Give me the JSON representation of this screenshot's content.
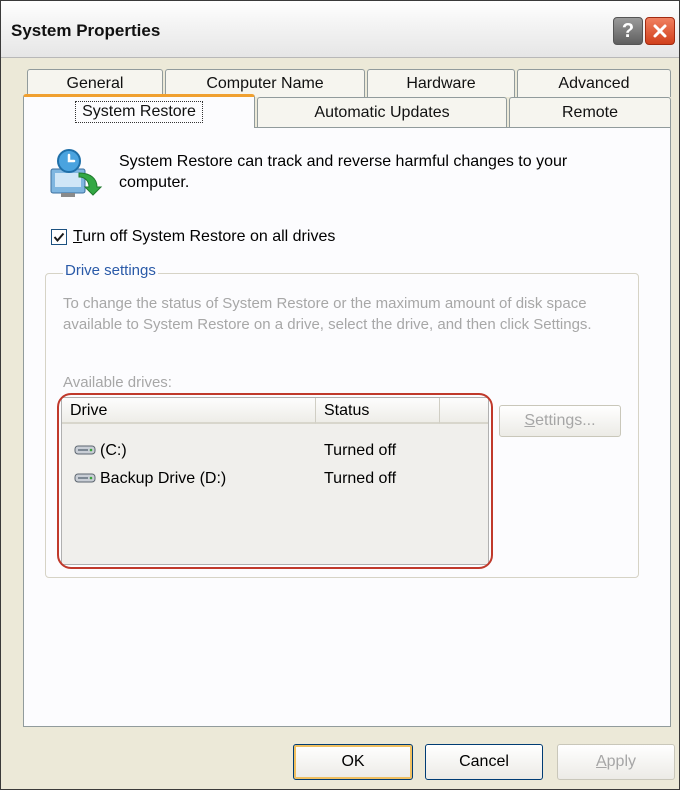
{
  "window": {
    "title": "System Properties",
    "help_glyph": "?",
    "icons": {
      "help": "question-mark-icon",
      "close": "close-icon"
    },
    "colors": {
      "accent_tab": "#f0a030",
      "close_button": "#d1401c",
      "highlight_ring": "#c0392b",
      "group_legend": "#2a5aa8"
    }
  },
  "tabs": {
    "back_row": [
      "General",
      "Computer Name",
      "Hardware",
      "Advanced"
    ],
    "front_row": [
      "System Restore",
      "Automatic Updates",
      "Remote"
    ],
    "active": "System Restore"
  },
  "intro": {
    "icon": "system-restore-icon",
    "text": "System Restore can track and reverse harmful changes to your computer."
  },
  "turn_off": {
    "checked": true,
    "label_accel": "T",
    "label_rest": "urn off System Restore on all drives"
  },
  "drive_settings": {
    "legend": "Drive settings",
    "description": "To change the status of System Restore or the maximum amount of disk space available to System Restore on a drive, select the drive, and then click Settings.",
    "available_label": "Available drives:",
    "columns": [
      "Drive",
      "Status"
    ],
    "rows": [
      {
        "drive": "(C:)",
        "status": "Turned off",
        "icon": "hard-drive-icon"
      },
      {
        "drive": "Backup Drive (D:)",
        "status": "Turned off",
        "icon": "hard-drive-icon"
      }
    ],
    "settings_button": {
      "accel": "S",
      "rest": "ettings..."
    }
  },
  "footer": {
    "ok": "OK",
    "cancel": "Cancel",
    "apply_accel": "A",
    "apply_rest": "pply"
  }
}
